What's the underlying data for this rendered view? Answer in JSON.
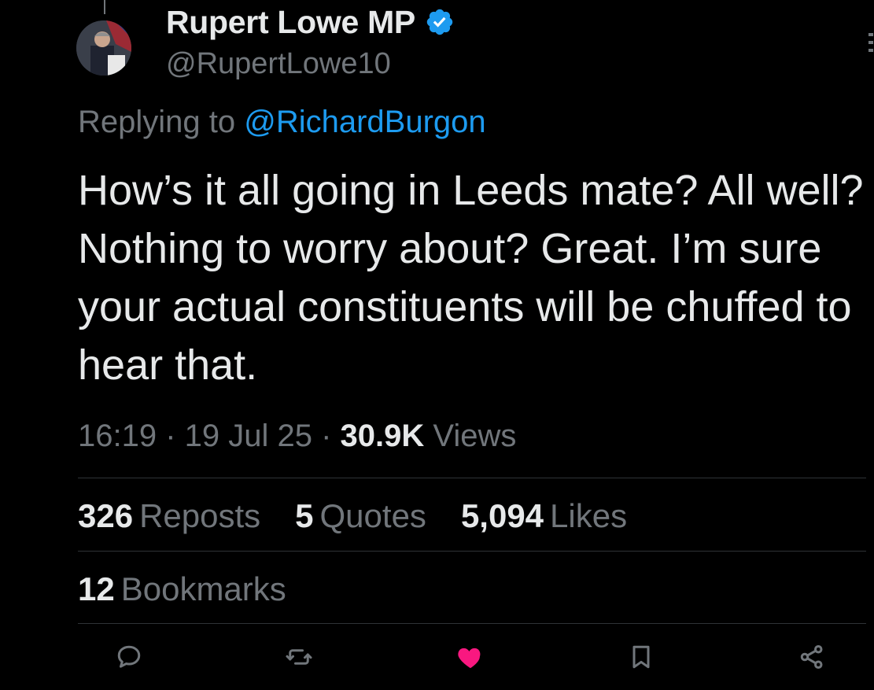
{
  "author": {
    "display_name": "Rupert Lowe MP",
    "handle": "@RupertLowe10"
  },
  "reply": {
    "prefix": "Replying to ",
    "mention": "@RichardBurgon"
  },
  "tweet": {
    "text": "How’s it all going in Leeds mate? All well? Nothing to worry about? Great. I’m sure your actual constituents will be chuffed to hear that."
  },
  "meta": {
    "time": "16:19",
    "separator": " · ",
    "date": "19 Jul 25",
    "views_count": "30.9K",
    "views_label": " Views"
  },
  "stats": {
    "reposts": {
      "count": "326",
      "label": "Reposts"
    },
    "quotes": {
      "count": "5",
      "label": "Quotes"
    },
    "likes": {
      "count": "5,094",
      "label": "Likes"
    },
    "bookmarks": {
      "count": "12",
      "label": "Bookmarks"
    }
  },
  "actions": {
    "icons": [
      "reply-icon",
      "repost-icon",
      "like-icon",
      "bookmark-icon",
      "share-icon"
    ],
    "liked": true
  },
  "colors": {
    "background": "#000000",
    "text_primary": "#e7e9ea",
    "text_secondary": "#71767b",
    "link": "#1d9bf0",
    "verified": "#1d9bf0",
    "like_active": "#f91880",
    "divider": "#2f3336"
  }
}
